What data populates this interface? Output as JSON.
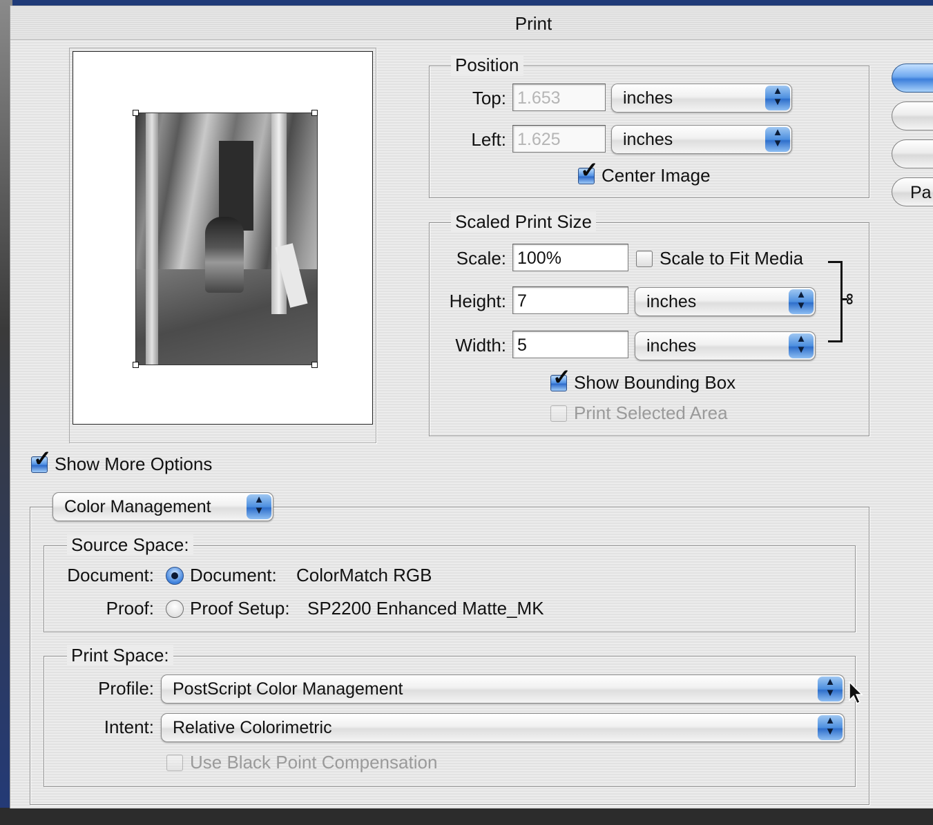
{
  "window": {
    "title": "Print"
  },
  "position": {
    "legend": "Position",
    "top_label": "Top:",
    "top_value": "1.653",
    "top_unit": "inches",
    "left_label": "Left:",
    "left_value": "1.625",
    "left_unit": "inches",
    "center_image_label": "Center Image",
    "center_image_checked": true
  },
  "scaled_print_size": {
    "legend": "Scaled Print Size",
    "scale_label": "Scale:",
    "scale_value": "100%",
    "scale_to_fit_label": "Scale to Fit Media",
    "scale_to_fit_checked": false,
    "height_label": "Height:",
    "height_value": "7",
    "height_unit": "inches",
    "width_label": "Width:",
    "width_value": "5",
    "width_unit": "inches",
    "show_bounding_box_label": "Show Bounding Box",
    "show_bounding_box_checked": true,
    "print_selected_area_label": "Print Selected Area",
    "print_selected_area_enabled": false
  },
  "buttons": {
    "page_setup_partial": "Pa"
  },
  "show_more_options": {
    "label": "Show More Options",
    "checked": true
  },
  "options_popup": {
    "selected": "Color Management"
  },
  "source_space": {
    "legend": "Source Space:",
    "document_label": "Document:",
    "document_radio_text": "Document:",
    "document_profile": "ColorMatch RGB",
    "document_selected": true,
    "proof_label": "Proof:",
    "proof_radio_text": "Proof Setup:",
    "proof_profile": "SP2200 Enhanced Matte_MK",
    "proof_selected": false
  },
  "print_space": {
    "legend": "Print Space:",
    "profile_label": "Profile:",
    "profile_value": "PostScript Color Management",
    "intent_label": "Intent:",
    "intent_value": "Relative Colorimetric",
    "bpc_label": "Use Black Point Compensation",
    "bpc_enabled": false
  },
  "icons": [
    "checkmark-icon",
    "popup-arrows-icon",
    "chain-link-icon",
    "radio-icon",
    "mouse-pointer-icon"
  ],
  "colors": {
    "aqua_blue": "#4d8fe0",
    "window_bg": "#ececec",
    "desktop": "#1f3a78"
  }
}
